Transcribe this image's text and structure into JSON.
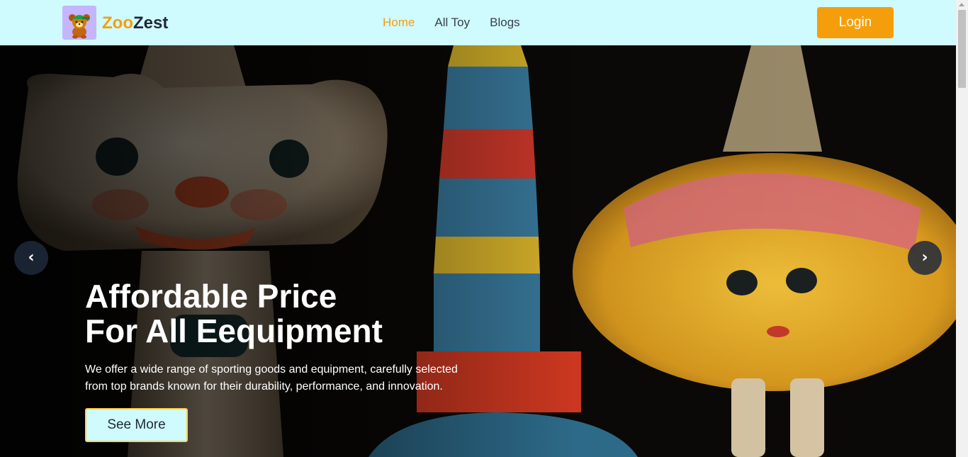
{
  "brand": {
    "name_part1": "Zoo",
    "name_part2": "Zest",
    "logo_icon": "teddy-bear-icon"
  },
  "nav": {
    "links": [
      {
        "label": "Home",
        "active": true
      },
      {
        "label": "All Toy",
        "active": false
      },
      {
        "label": "Blogs",
        "active": false
      }
    ],
    "login_label": "Login"
  },
  "hero": {
    "title_line1": "Affordable Price",
    "title_line2": "For All Eequipment",
    "description": "We offer a wide range of sporting goods and equipment, carefully selected from top brands known for their durability, performance, and innovation.",
    "cta_label": "See More",
    "prev_icon": "chevron-left-icon",
    "next_icon": "chevron-right-icon",
    "prev_glyph": "‹",
    "next_glyph": "›"
  },
  "colors": {
    "accent": "#f59e0b",
    "navbar_bg": "#cffafe",
    "logo_bg": "#c4b5fd",
    "text_dark": "#1f2937"
  }
}
